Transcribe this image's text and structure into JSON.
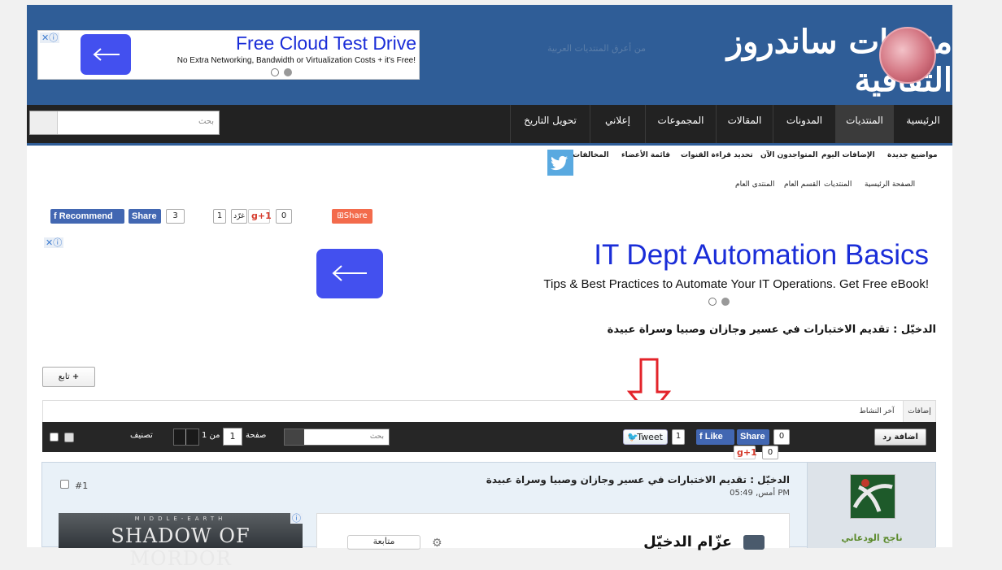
{
  "header": {
    "logo_text": "منتديات ساندروز الثقافية",
    "logo_sub": "من أعرق المنتديات العربية",
    "top_ad": {
      "title": "Free Cloud Test Drive",
      "subtitle": "No Extra Networking, Bandwidth or Virtualization Costs + it's Free!"
    }
  },
  "nav": {
    "items": [
      "الرئيسية",
      "المنتديات",
      "المدونات",
      "المقالات",
      "المجموعات",
      "إعلاني",
      "تحويل التاريخ"
    ],
    "search_placeholder": "بحث"
  },
  "sublinks": [
    "مواضيع جديدة",
    "الإضافات اليوم",
    "المتواجدون الآن",
    "تحديد قراءة القنوات",
    "قائمة الأعضاء",
    "المخالفات"
  ],
  "breadcrumb": [
    "الصفحة الرئيسية",
    "المنتديات",
    "القسم العام",
    "المنتدى العام"
  ],
  "social": {
    "fb_recommend": "Recommend",
    "fb_share": "Share",
    "fb_count": "3",
    "gplus_count_left": "1",
    "gplus_tag": "غرّد",
    "gplus_label": "g+1",
    "gplus_count": "0",
    "addthis_share": "Share"
  },
  "main_ad": {
    "headline": "IT Dept Automation Basics",
    "subline": "Tips & Best Practices to Automate Your IT Operations. Get Free eBook!"
  },
  "thread": {
    "title": "الدخيّل : تقديم الاختبارات في عسير وجازان وصبيا وسراة عبيدة",
    "follow_label": "تابع",
    "follow_plus": "+"
  },
  "tabs": [
    "إضافات",
    "آخر النشاط"
  ],
  "toolbar": {
    "reply": "اضافة رد",
    "fb_like": "Like",
    "fb_share": "Share",
    "fb_count": "0",
    "gplus": "g+1",
    "gplus_count": "0",
    "tweet": "Tweet",
    "tweet_count": "1",
    "search_placeholder": "بحث",
    "page_label": "صفحة",
    "page_current": "1",
    "page_of": "من 1",
    "sort_label": "تصنيف"
  },
  "post": {
    "number": "#1",
    "title": "الدخيّل : تقديم الاختبارات في عسير وجازان وصبيا وسراة عبيدة",
    "time": "أمس, 05:49 PM",
    "username": "ناجح الودعاني",
    "ad_top": "MIDDLE-EARTH",
    "ad_title": "SHADOW OF MORDOR",
    "embed_name": "عزّام الدخيّل",
    "embed_follow": "متابعة"
  },
  "colors": {
    "header_blue": "#2f5d97",
    "nav_dark": "#222222",
    "fb_blue": "#4267b2",
    "ad_button": "#4350ef",
    "arrow_red": "#e3232a"
  }
}
